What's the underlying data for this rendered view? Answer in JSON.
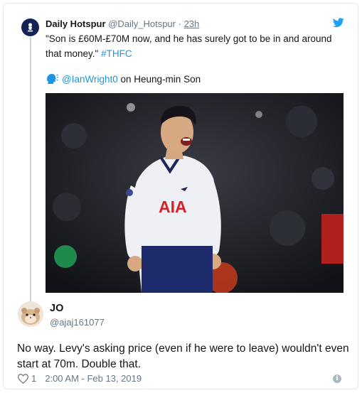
{
  "quoted_tweet": {
    "display_name": "Daily Hotspur",
    "handle": "@Daily_Hotspur",
    "separator": "·",
    "time": "23h",
    "text": "\"Son is £60M-£70M now, and he has surely got to be in and around that money.\"",
    "hashtag": "#THFC",
    "speaker_icon": "speaking-head-icon",
    "mention": "@IanWright0",
    "mention_suffix": "on Heung-min Son",
    "photo_text": "AIA"
  },
  "reply_tweet": {
    "display_name": "JO",
    "handle": "@ajaj161077",
    "text": "No way. Levy's asking price (even if he were to leave) wouldn't even start at 70m. Double that.",
    "likes": "1",
    "timestamp": "2:00 AM - Feb 13, 2019"
  },
  "colors": {
    "link": "#1b95e0",
    "muted": "#657786",
    "thread_line": "#ccd6dd",
    "twitter_blue": "#1da1f2",
    "spurs_navy": "#132257"
  },
  "icons": [
    "twitter-bird-icon",
    "speaking-head-icon",
    "heart-icon",
    "info-icon"
  ]
}
